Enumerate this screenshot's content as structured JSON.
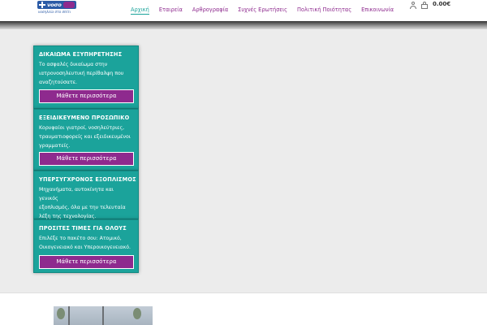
{
  "header": {
    "logo": {
      "wordmark": "νοσο",
      "tagline": "νοσηλεία στο σπίτι"
    },
    "nav": [
      {
        "label": "Αρχική",
        "active": true
      },
      {
        "label": "Εταιρεία",
        "active": false
      },
      {
        "label": "Αρθρογραφία",
        "active": false
      },
      {
        "label": "Συχνές Ερωτήσεις",
        "active": false
      },
      {
        "label": "Πολιτική Ποιότητας",
        "active": false
      },
      {
        "label": "Επικοινωνία",
        "active": false
      }
    ],
    "icons": {
      "account": "user-icon",
      "cart": "shopping-bag-icon"
    },
    "cart_total": "0.00€"
  },
  "cards": [
    {
      "title": "ΔΙΚΑΙΩΜΑ ΕΞΥΠΗΡΕΤΗΣΗΣ",
      "lines": [
        "Το ασφαλές δικαίωμα στην",
        "ιατρονοσηλευτική περίθαλψη που",
        "αναζητούσατε."
      ],
      "button": "Μάθετε περισσότερα"
    },
    {
      "title": "ΕΞΕΙΔΙΚΕΥΜΕΝΟ ΠΡΟΣΩΠΙΚΟ",
      "lines": [
        "Κορυφαίοι γιατροί, νοσηλεύτριες,",
        "τραυματιοφορείς και εξειδικευμένοι",
        "γραμματείς."
      ],
      "button": "Μάθετε περισσότερα"
    },
    {
      "title": "ΥΠΕΡΣΥΓΧΡΟΝΟΣ ΕΞΟΠΛΙΣΜΟΣ",
      "lines": [
        "Μηχανήματα, αυτοκίνητα και γενικός",
        "εξοπλισμός, όλα με την τελευταία",
        "λέξη της τεχνολογίας."
      ],
      "button": "Μάθετε περισσότερα"
    },
    {
      "title": "ΠΡΟΣΙΤΕΣ ΤΙΜΕΣ ΓΙΑ ΟΛΟΥΣ",
      "lines": [
        "Επιλέξε το πακέτο σου: Ατομικό,",
        "Οικογενειακό και Υπεροικογενειακό."
      ],
      "button": "Μάθετε περισσότερα"
    }
  ],
  "colors": {
    "teal": "#1ba39b",
    "purple": "#8e2a8e",
    "nav_active": "#1aa39a",
    "hero_bg": "#ececec"
  }
}
